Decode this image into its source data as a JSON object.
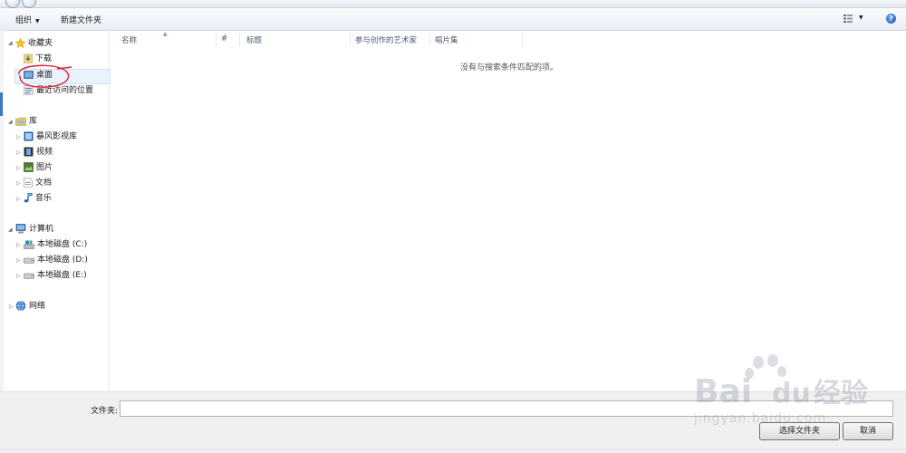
{
  "toolbar": {
    "organize_label": "组织",
    "new_folder_label": "新建文件夹"
  },
  "nav": {
    "favorites": {
      "label": "收藏夹",
      "items": [
        {
          "label": "下载"
        },
        {
          "label": "桌面"
        },
        {
          "label": "最近访问的位置"
        }
      ]
    },
    "libraries": {
      "label": "库",
      "items": [
        {
          "label": "暴风影视库"
        },
        {
          "label": "视频"
        },
        {
          "label": "图片"
        },
        {
          "label": "文档"
        },
        {
          "label": "音乐"
        }
      ]
    },
    "computer": {
      "label": "计算机",
      "items": [
        {
          "label": "本地磁盘 (C:)"
        },
        {
          "label": "本地磁盘 (D:)"
        },
        {
          "label": "本地磁盘 (E:)"
        }
      ]
    },
    "network": {
      "label": "网络"
    }
  },
  "columns": [
    "名称",
    "#",
    "标题",
    "参与创作的艺术家",
    "唱片集"
  ],
  "empty_message": "没有与搜索条件匹配的项。",
  "footer": {
    "folder_label": "文件夹:",
    "folder_value": "",
    "select_button": "选择文件夹",
    "cancel_button": "取消"
  },
  "watermark": {
    "brand": "Bai",
    "brand_tail": "du",
    "brand_cn": "经验",
    "url": "jingyan.baidu.com"
  },
  "colors": {
    "accent": "#3b78c7",
    "selection": "#eaf3fd",
    "annotation": "#e0262b"
  }
}
